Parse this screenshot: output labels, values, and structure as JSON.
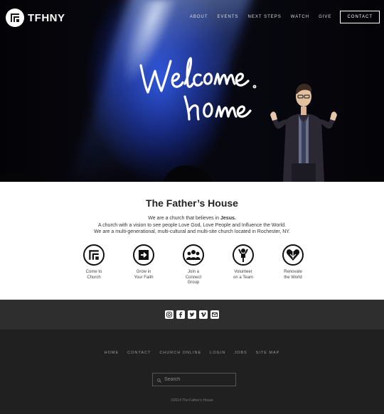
{
  "header": {
    "logo_text": "TFHNY",
    "nav": [
      "ABOUT",
      "EVENTS",
      "NEXT STEPS",
      "WATCH",
      "GIVE"
    ],
    "contact_label": "CONTACT"
  },
  "hero": {
    "script_line1": "Welcome",
    "script_line2": "home"
  },
  "intro": {
    "title": "The Father’s House",
    "line1_prefix": "We are a church that believes in ",
    "line1_bold": "Jesus.",
    "line2": "A church with a vision to see people Love God, Love People and Influence the World.",
    "line3": "We are a multi-generational, multi-cultural and multi-site church located in Rochester, NY."
  },
  "ctas": [
    {
      "line1": "Come to",
      "line2": "Church",
      "line3": "",
      "icon": "church-logo-icon"
    },
    {
      "line1": "Grow in",
      "line2": "Your Faith",
      "line3": "",
      "icon": "arrow-right-icon"
    },
    {
      "line1": "Join a",
      "line2": "Connect",
      "line3": "Group",
      "icon": "group-icon"
    },
    {
      "line1": "Volunteer",
      "line2": "on a Team",
      "line3": "",
      "icon": "volunteer-icon"
    },
    {
      "line1": "Renovate",
      "line2": "the World",
      "line3": "",
      "icon": "heart-icon"
    }
  ],
  "social": [
    "instagram-icon",
    "facebook-icon",
    "twitter-icon",
    "vimeo-icon",
    "email-icon"
  ],
  "footer": {
    "nav": [
      "HOME",
      "CONTACT",
      "CHURCH ONLINE",
      "LOGIN",
      "JOBS",
      "SITE MAP"
    ],
    "search_placeholder": "Search",
    "copyright": "©2014 The Father's House"
  },
  "colors": {
    "hero_blue": "#2a52e0",
    "footer_dark": "#202020",
    "social_band": "#2e2e2e"
  }
}
